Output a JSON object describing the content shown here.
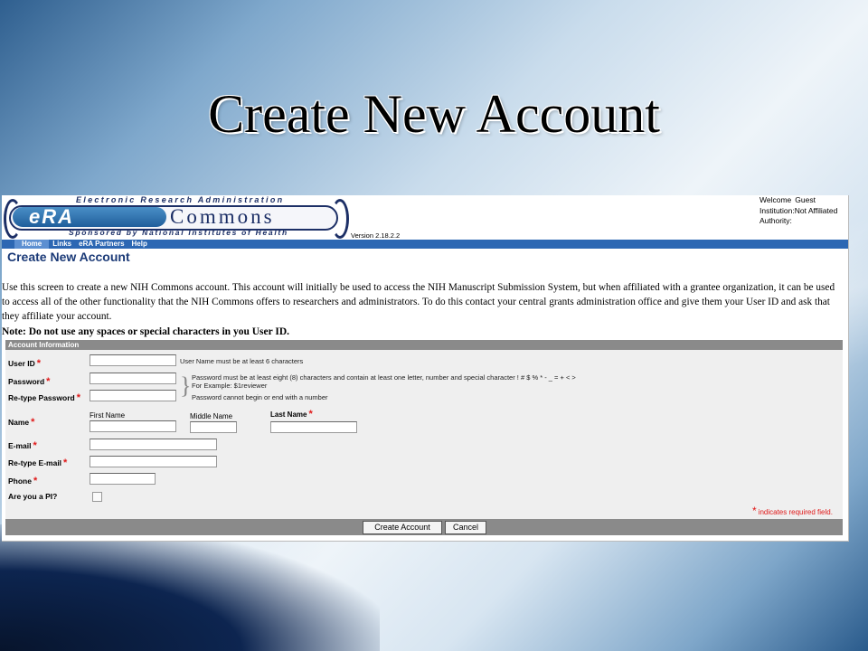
{
  "slide": {
    "title": "Create New Account"
  },
  "header": {
    "logo": {
      "top_text": "Electronic Research Administration",
      "era_text": "eRA",
      "commons_text": "Commons",
      "bottom_text": "Sponsored by National Institutes of Health"
    },
    "version": "Version 2.18.2.2",
    "welcome": [
      {
        "label": "Welcome",
        "value": "Guest"
      },
      {
        "label": "Institution:",
        "value": "Not Affiliated"
      },
      {
        "label": "Authority:",
        "value": ""
      }
    ],
    "colors": {
      "brand_blue": "#1c2f66",
      "nav_blue": "#2c67b3"
    }
  },
  "nav": {
    "items": [
      "Home",
      "Links",
      "eRA Partners",
      "Help"
    ]
  },
  "page": {
    "heading": "Create New Account",
    "intro": "Use this screen to create a new NIH Commons account. This account will initially be used to access the NIH Manuscript Submission System, but when affiliated with a grantee organization, it can be used to access all of the other functionality that the NIH Commons offers to researchers and administrators. To do this contact your central grants administration office and give them your User ID and ask that they affiliate your account.",
    "note": "Note: Do not use any spaces or special characters in you User ID."
  },
  "form": {
    "section_title": "Account Information",
    "required_marker": "*",
    "fields": {
      "user_id": {
        "label": "User ID",
        "value": "",
        "hint": "User Name must be at least 6 characters"
      },
      "password": {
        "label": "Password",
        "value": ""
      },
      "retype_password": {
        "label": "Re-type Password",
        "value": ""
      },
      "password_hints": [
        "Password must be at least eight (8) characters and contain at least one letter, number and special character ! # $ % * - _ = + < >",
        "For Example: $1reviewer",
        "Password cannot begin or end with a number"
      ],
      "name": {
        "label": "Name",
        "first": {
          "label": "First Name",
          "value": ""
        },
        "middle": {
          "label": "Middle Name",
          "value": ""
        },
        "last": {
          "label": "Last Name",
          "value": ""
        }
      },
      "email": {
        "label": "E-mail",
        "value": ""
      },
      "retype_email": {
        "label": "Re-type E-mail",
        "value": ""
      },
      "phone": {
        "label": "Phone",
        "value": ""
      },
      "is_pi": {
        "label": "Are you a PI?",
        "checked": false
      }
    },
    "required_note": "indicates required field.",
    "buttons": {
      "create": "Create Account",
      "cancel": "Cancel"
    }
  }
}
